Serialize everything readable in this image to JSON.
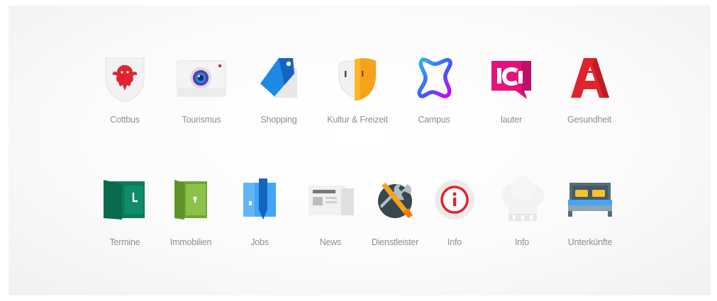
{
  "grid": {
    "row1": [
      {
        "label": "Cottbus",
        "icon": "coat-of-arms-icon"
      },
      {
        "label": "Tourismus",
        "icon": "camera-icon"
      },
      {
        "label": "Shopping",
        "icon": "price-tag-icon"
      },
      {
        "label": "Kultur & Freizeit",
        "icon": "theater-mask-icon"
      },
      {
        "label": "Campus",
        "icon": "campus-icon"
      },
      {
        "label": "lauter",
        "icon": "lauter-logo-icon"
      },
      {
        "label": "Gesundheit",
        "icon": "pharmacy-icon"
      }
    ],
    "row2": [
      {
        "label": "Termine",
        "icon": "calendar-door-icon"
      },
      {
        "label": "Immobilien",
        "icon": "door-icon"
      },
      {
        "label": "Jobs",
        "icon": "jobs-icon"
      },
      {
        "label": "News",
        "icon": "newspaper-icon"
      },
      {
        "label": "Dienstleister",
        "icon": "tools-icon"
      },
      {
        "label": "Info",
        "icon": "info-icon"
      },
      {
        "label": "Info",
        "icon": "chef-hat-icon"
      },
      {
        "label": "Unterkünfte",
        "icon": "bed-icon"
      }
    ]
  },
  "colors": {
    "label": "#8f8f8f",
    "red": "#e0242e",
    "blue": "#1e88e5",
    "orange": "#f7a21b",
    "magenta": "#e4127a",
    "green_dark": "#0b7a5a",
    "green_light": "#7cb342"
  }
}
